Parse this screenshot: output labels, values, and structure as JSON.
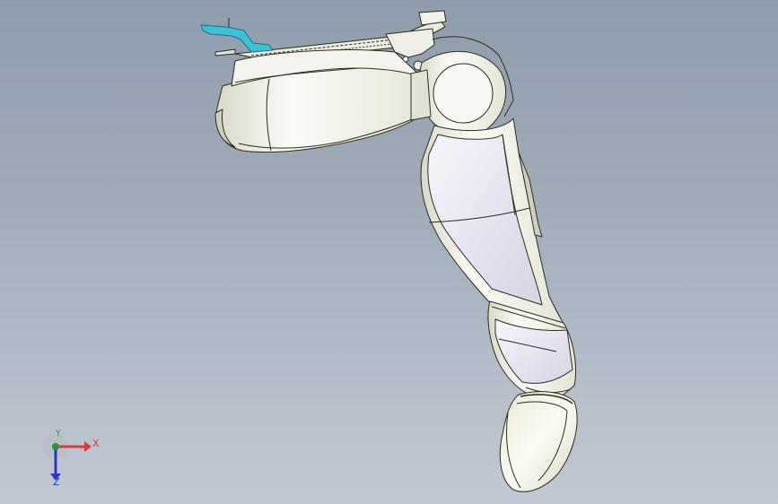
{
  "viewport": {
    "background_top": "#8f9cab",
    "background_bottom": "#c2c9d3"
  },
  "model": {
    "part_fill": "#f2f2ec",
    "part_shade": "#dcdcce",
    "edge_color": "#2b2f1f",
    "highlight_fill": "#39c1d6",
    "inner_fill": "#e9e7f2"
  },
  "triad": {
    "x_label": "X",
    "y_label": "Y",
    "z_label": "Z",
    "x_color": "#d93c3c",
    "y_color": "#1f9b2f",
    "z_color": "#2a34c8"
  }
}
